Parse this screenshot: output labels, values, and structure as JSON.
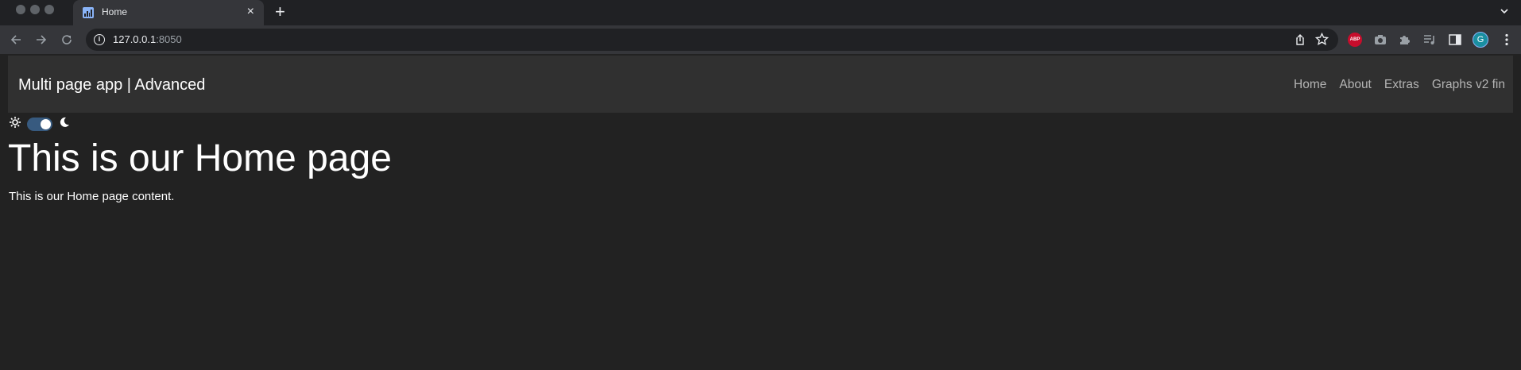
{
  "browser": {
    "tab": {
      "title": "Home",
      "favicon": "bar-chart-icon"
    },
    "address": {
      "host": "127.0.0.1",
      "port": ":8050"
    },
    "extensions": {
      "abp_label": "ABP",
      "profile_initial": "G"
    }
  },
  "app": {
    "brand": "Multi page app | Advanced",
    "nav": [
      {
        "label": "Home"
      },
      {
        "label": "About"
      },
      {
        "label": "Extras"
      },
      {
        "label": "Graphs v2 fin"
      }
    ],
    "theme_switch": {
      "state": "on"
    }
  },
  "page": {
    "heading": "This is our Home page",
    "content": "This is our Home page content."
  },
  "colors": {
    "background": "#222222",
    "navbar": "#303030",
    "switch_accent": "#375a7f",
    "chrome_dark": "#202124",
    "chrome_toolbar": "#35363a"
  }
}
